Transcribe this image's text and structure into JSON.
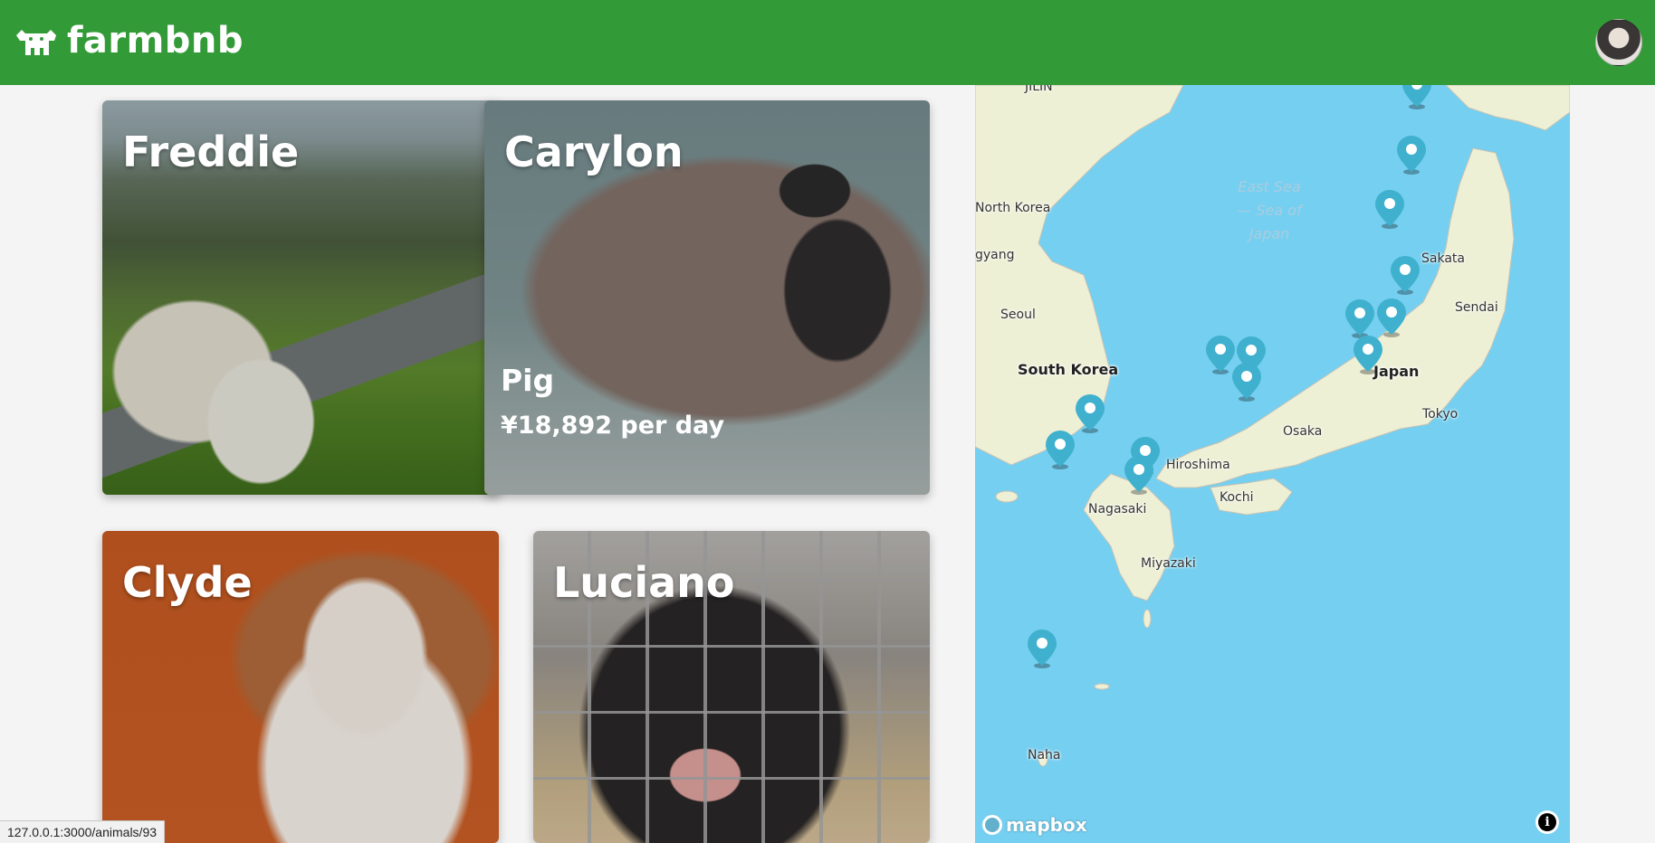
{
  "header": {
    "brand_name": "farmbnb",
    "brand_icon": "cow-icon",
    "avatar_icon": "user-avatar"
  },
  "cards": [
    {
      "name": "Freddie"
    },
    {
      "name": "Carylon",
      "species": "Pig",
      "price": "¥18,892 per day"
    },
    {
      "name": "Clyde"
    },
    {
      "name": "Luciano"
    }
  ],
  "map": {
    "labels": {
      "north_korea": "North Korea",
      "pyongyang": "gyang",
      "seoul": "Seoul",
      "south_korea": "South Korea",
      "east_sea": "East Sea — Sea of Japan",
      "sakata": "Sakata",
      "sendai": "Sendai",
      "japan": "Japan",
      "tokyo": "Tokyo",
      "osaka": "Osaka",
      "hiroshima": "Hiroshima",
      "kochi": "Kochi",
      "nagasaki": "Nagasaki",
      "miyazaki": "Miyazaki",
      "naha": "Naha",
      "top_partial": "JILIN"
    },
    "attribution": "mapbox",
    "marker_color": "#3fb1ce",
    "land_color": "#eef0d6",
    "water_color": "#75cff0"
  },
  "status_bar": {
    "url": "127.0.0.1:3000/animals/93"
  }
}
